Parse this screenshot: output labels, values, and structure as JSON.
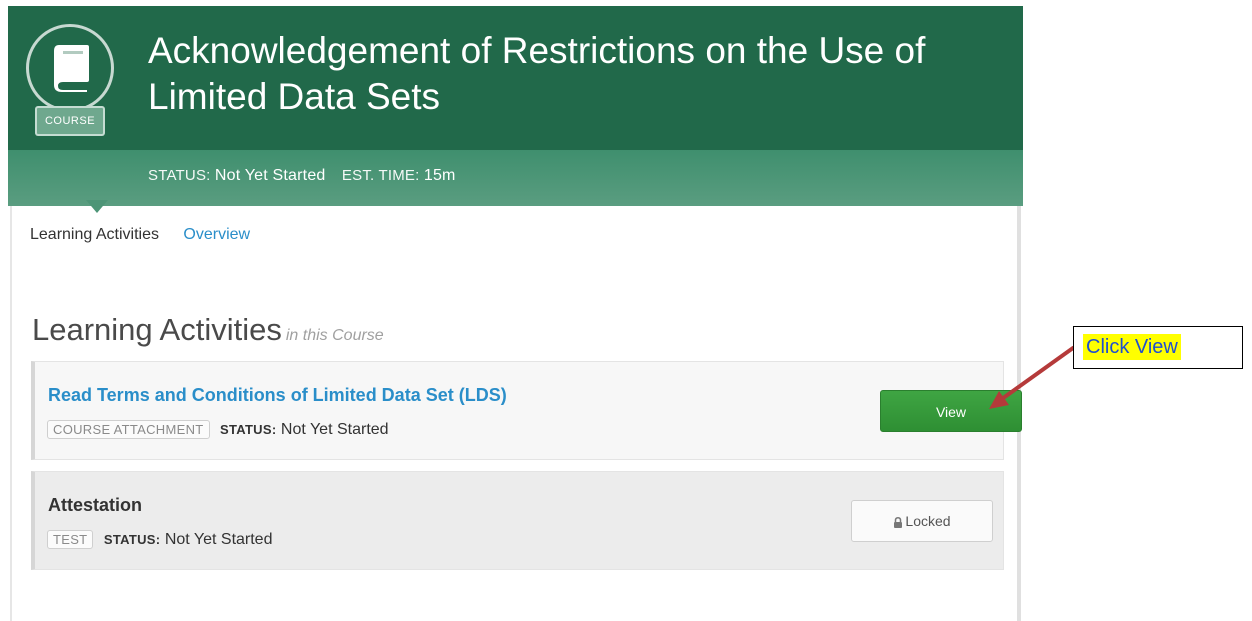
{
  "course": {
    "badge_label": "COURSE",
    "title": "Acknowledgement of Restrictions on the Use of Limited Data Sets",
    "status_label": "STATUS:",
    "status_value": "Not Yet Started",
    "time_label": "EST. TIME:",
    "time_value": "15m"
  },
  "tabs": {
    "active": "Learning Activities",
    "overview": "Overview"
  },
  "section": {
    "title": "Learning Activities",
    "subtitle": "in this Course"
  },
  "activities": [
    {
      "name": "Read Terms and Conditions of Limited Data Set (LDS)",
      "type": "COURSE ATTACHMENT",
      "status_label": "STATUS:",
      "status_value": "Not Yet Started",
      "button": "View"
    },
    {
      "name": "Attestation",
      "type": "TEST",
      "status_label": "STATUS:",
      "status_value": "Not Yet Started",
      "button": "Locked"
    }
  ],
  "callout": {
    "text": "Click View"
  },
  "colors": {
    "header_green": "#21694a",
    "status_bar_green": "#4d9577",
    "link_blue": "#2a8ec9",
    "view_button_green": "#3a9d3f",
    "callout_highlight": "#ffff00",
    "arrow_red": "#b53a3a"
  },
  "icons": {
    "course": "book-icon",
    "locked": "lock-icon",
    "pointer": "arrow-icon"
  }
}
